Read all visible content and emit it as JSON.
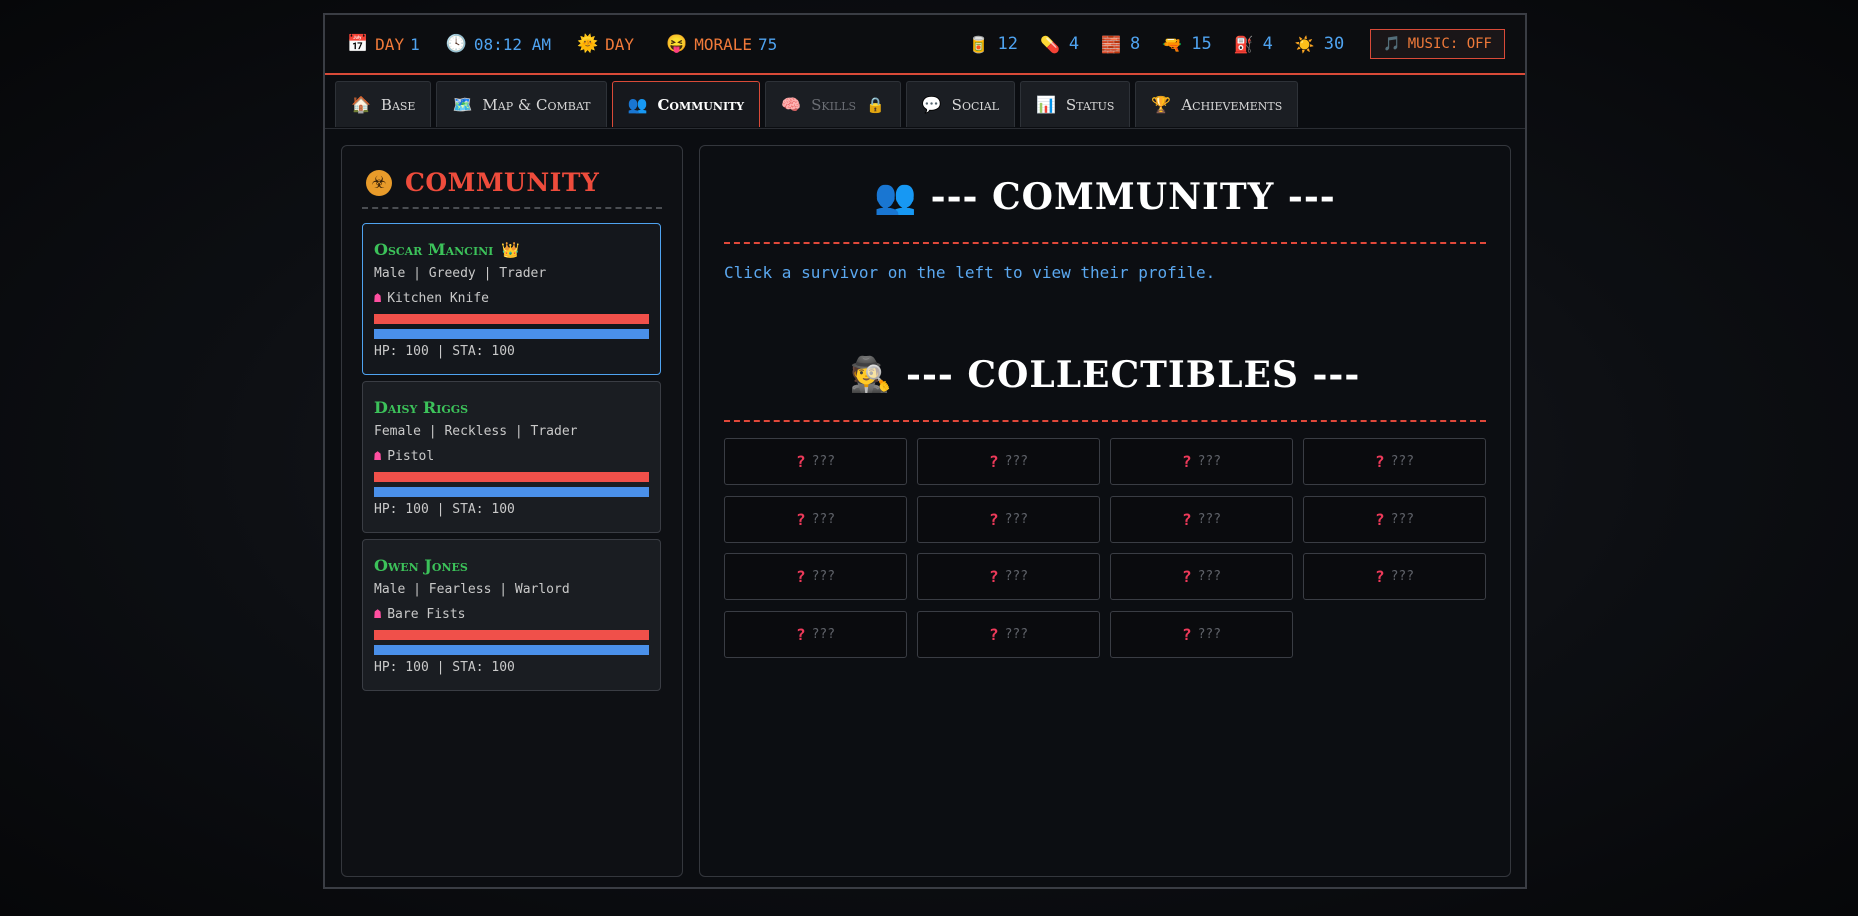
{
  "topbar": {
    "day": {
      "icon": "📅",
      "label": "DAY",
      "value": "1"
    },
    "time": {
      "icon": "🕓",
      "value": "08:12 AM"
    },
    "phase": {
      "icon": "🌞",
      "label": "DAY"
    },
    "morale": {
      "icon": "😝",
      "label": "MORALE",
      "value": "75"
    },
    "resources": [
      {
        "icon": "🥫",
        "value": "12"
      },
      {
        "icon": "💊",
        "value": "4"
      },
      {
        "icon": "🧱",
        "value": "8"
      },
      {
        "icon": "🔫",
        "value": "15"
      },
      {
        "icon": "⛽",
        "value": "4"
      },
      {
        "icon": "☀️",
        "value": "30"
      }
    ],
    "music": {
      "icon": "🎵",
      "label": "MUSIC: OFF"
    }
  },
  "tabs": [
    {
      "icon": "🏠",
      "label": "Base"
    },
    {
      "icon": "🗺️",
      "label": "Map & Combat"
    },
    {
      "icon": "👥",
      "label": "Community"
    },
    {
      "icon": "🧠",
      "label": "Skills",
      "lock": "🔒"
    },
    {
      "icon": "💬",
      "label": "Social"
    },
    {
      "icon": "📊",
      "label": "Status"
    },
    {
      "icon": "🏆",
      "label": "Achievements"
    }
  ],
  "left": {
    "icon": "☣",
    "title": "COMMUNITY",
    "survivors": [
      {
        "name": "Oscar Mancini",
        "crown": "👑",
        "meta": "Male | Greedy | Trader",
        "weapon_icon": "☗",
        "weapon": "Kitchen Knife",
        "stats": "HP: 100 | STA: 100",
        "hp": 1.0,
        "sta": 1.0
      },
      {
        "name": "Daisy Riggs",
        "meta": "Female | Reckless | Trader",
        "weapon_icon": "☗",
        "weapon": "Pistol",
        "stats": "HP: 100 | STA: 100",
        "hp": 1.0,
        "sta": 1.0
      },
      {
        "name": "Owen Jones",
        "meta": "Male | Fearless | Warlord",
        "weapon_icon": "☗",
        "weapon": "Bare Fists",
        "stats": "HP: 100 | STA: 100",
        "hp": 1.0,
        "sta": 1.0
      }
    ]
  },
  "right": {
    "community": {
      "icon": "👥",
      "title": "--- COMMUNITY ---"
    },
    "hint": "Click a survivor on the left to view their profile.",
    "collectibles": {
      "icon": "🕵️",
      "title": "--- COLLECTIBLES ---"
    },
    "items": [
      "???",
      "???",
      "???",
      "???",
      "???",
      "???",
      "???",
      "???",
      "???",
      "???",
      "???",
      "???",
      "???",
      "???",
      "???"
    ],
    "item_icon": "?"
  },
  "colors": {
    "accent": "#d94a38",
    "blue": "#4fa3f0",
    "orange": "#f07a3a",
    "green": "#3cc25a",
    "hp": "#f0504a",
    "sta": "#4a90ea"
  }
}
